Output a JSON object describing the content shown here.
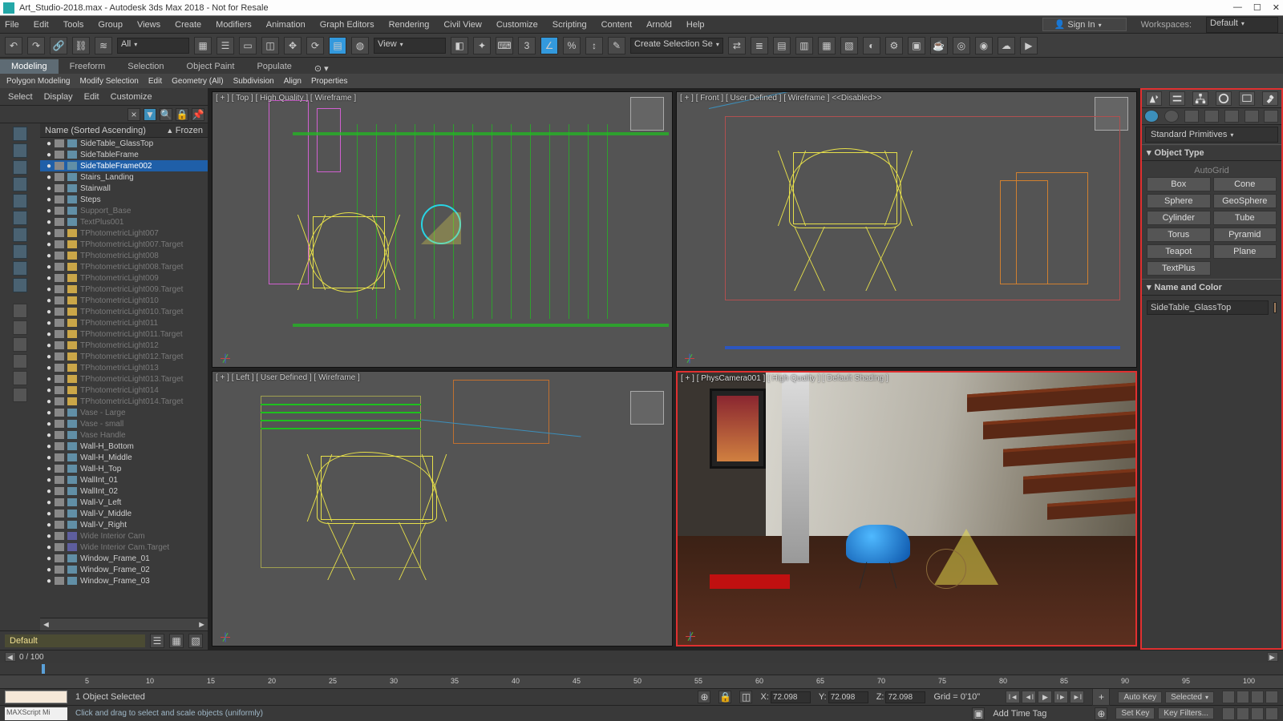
{
  "title": "Art_Studio-2018.max - Autodesk 3ds Max 2018 - Not for Resale",
  "menu": [
    "File",
    "Edit",
    "Tools",
    "Group",
    "Views",
    "Create",
    "Modifiers",
    "Animation",
    "Graph Editors",
    "Rendering",
    "Civil View",
    "Customize",
    "Scripting",
    "Content",
    "Arnold",
    "Help"
  ],
  "signin": "Sign In",
  "workspaces_label": "Workspaces:",
  "workspaces_value": "Default",
  "toolrow": {
    "all": "All",
    "view": "View",
    "create_sel": "Create Selection Se"
  },
  "ribbon": {
    "tabs": [
      "Modeling",
      "Freeform",
      "Selection",
      "Object Paint",
      "Populate"
    ],
    "sub": [
      "Polygon Modeling",
      "Modify Selection",
      "Edit",
      "Geometry (All)",
      "Subdivision",
      "Align",
      "Properties"
    ]
  },
  "scene": {
    "tabs": [
      "Select",
      "Display",
      "Edit",
      "Customize"
    ],
    "header_name": "Name (Sorted Ascending)",
    "header_frozen": "Frozen",
    "items": [
      {
        "name": "SideTable_GlassTop",
        "type": "geom",
        "sel": false,
        "dim": false
      },
      {
        "name": "SideTableFrame",
        "type": "geom",
        "sel": false,
        "dim": false
      },
      {
        "name": "SideTableFrame002",
        "type": "geom",
        "sel": true,
        "dim": false
      },
      {
        "name": "Stairs_Landing",
        "type": "geom",
        "sel": false,
        "dim": false
      },
      {
        "name": "Stairwall",
        "type": "geom",
        "sel": false,
        "dim": false
      },
      {
        "name": "Steps",
        "type": "geom",
        "sel": false,
        "dim": false
      },
      {
        "name": "Support_Base",
        "type": "geom",
        "sel": false,
        "dim": true
      },
      {
        "name": "TextPlus001",
        "type": "geom",
        "sel": false,
        "dim": true
      },
      {
        "name": "TPhotometricLight007",
        "type": "light",
        "sel": false,
        "dim": true
      },
      {
        "name": "TPhotometricLight007.Target",
        "type": "light",
        "sel": false,
        "dim": true
      },
      {
        "name": "TPhotometricLight008",
        "type": "light",
        "sel": false,
        "dim": true
      },
      {
        "name": "TPhotometricLight008.Target",
        "type": "light",
        "sel": false,
        "dim": true
      },
      {
        "name": "TPhotometricLight009",
        "type": "light",
        "sel": false,
        "dim": true
      },
      {
        "name": "TPhotometricLight009.Target",
        "type": "light",
        "sel": false,
        "dim": true
      },
      {
        "name": "TPhotometricLight010",
        "type": "light",
        "sel": false,
        "dim": true
      },
      {
        "name": "TPhotometricLight010.Target",
        "type": "light",
        "sel": false,
        "dim": true
      },
      {
        "name": "TPhotometricLight011",
        "type": "light",
        "sel": false,
        "dim": true
      },
      {
        "name": "TPhotometricLight011.Target",
        "type": "light",
        "sel": false,
        "dim": true
      },
      {
        "name": "TPhotometricLight012",
        "type": "light",
        "sel": false,
        "dim": true
      },
      {
        "name": "TPhotometricLight012.Target",
        "type": "light",
        "sel": false,
        "dim": true
      },
      {
        "name": "TPhotometricLight013",
        "type": "light",
        "sel": false,
        "dim": true
      },
      {
        "name": "TPhotometricLight013.Target",
        "type": "light",
        "sel": false,
        "dim": true
      },
      {
        "name": "TPhotometricLight014",
        "type": "light",
        "sel": false,
        "dim": true
      },
      {
        "name": "TPhotometricLight014.Target",
        "type": "light",
        "sel": false,
        "dim": true
      },
      {
        "name": "Vase - Large",
        "type": "geom",
        "sel": false,
        "dim": true
      },
      {
        "name": "Vase - small",
        "type": "geom",
        "sel": false,
        "dim": true
      },
      {
        "name": "Vase Handle",
        "type": "geom",
        "sel": false,
        "dim": true
      },
      {
        "name": "Wall-H_Bottom",
        "type": "geom",
        "sel": false,
        "dim": false
      },
      {
        "name": "Wall-H_Middle",
        "type": "geom",
        "sel": false,
        "dim": false
      },
      {
        "name": "Wall-H_Top",
        "type": "geom",
        "sel": false,
        "dim": false
      },
      {
        "name": "WallInt_01",
        "type": "geom",
        "sel": false,
        "dim": false
      },
      {
        "name": "WallInt_02",
        "type": "geom",
        "sel": false,
        "dim": false
      },
      {
        "name": "Wall-V_Left",
        "type": "geom",
        "sel": false,
        "dim": false
      },
      {
        "name": "Wall-V_Middle",
        "type": "geom",
        "sel": false,
        "dim": false
      },
      {
        "name": "Wall-V_Right",
        "type": "geom",
        "sel": false,
        "dim": false
      },
      {
        "name": "Wide Interior Cam",
        "type": "cam",
        "sel": false,
        "dim": true
      },
      {
        "name": "Wide Interior Cam.Target",
        "type": "cam",
        "sel": false,
        "dim": true
      },
      {
        "name": "Window_Frame_01",
        "type": "geom",
        "sel": false,
        "dim": false
      },
      {
        "name": "Window_Frame_02",
        "type": "geom",
        "sel": false,
        "dim": false
      },
      {
        "name": "Window_Frame_03",
        "type": "geom",
        "sel": false,
        "dim": false
      }
    ],
    "layer": "Default"
  },
  "viewports": {
    "top": "[ + ] [ Top ] [ High Quality ] [ Wireframe ]",
    "front": "[ + ] [ Front ] [ User Defined ] [ Wireframe ]   <<Disabled>>",
    "left": "[ + ] [ Left ] [ User Defined ] [ Wireframe ]",
    "cam": "[ + ] [ PhysCamera001 ] [ High Quality ] [ Default Shading ]"
  },
  "cmd": {
    "dropdown": "Standard Primitives",
    "rollout_type": "Object Type",
    "autogrid": "AutoGrid",
    "types": [
      "Box",
      "Cone",
      "Sphere",
      "GeoSphere",
      "Cylinder",
      "Tube",
      "Torus",
      "Pyramid",
      "Teapot",
      "Plane",
      "TextPlus"
    ],
    "rollout_name": "Name and Color",
    "name_value": "SideTable_GlassTop"
  },
  "time": {
    "range": "0 / 100",
    "ticks": [
      5,
      10,
      15,
      20,
      25,
      30,
      35,
      40,
      45,
      50,
      55,
      60,
      65,
      70,
      75,
      80,
      85,
      90,
      95,
      100
    ]
  },
  "status": {
    "sel": "1 Object Selected",
    "hint": "Click and drag to select and scale objects (uniformly)",
    "maxscript": "MAXScript Mi",
    "x_label": "X:",
    "x": "72.098",
    "y_label": "Y:",
    "y": "72.098",
    "z_label": "Z:",
    "z": "72.098",
    "grid": "Grid = 0'10\"",
    "add_tag": "Add Time Tag",
    "autokey": "Auto Key",
    "setkey": "Set Key",
    "selected": "Selected",
    "keyfilters": "Key Filters..."
  }
}
